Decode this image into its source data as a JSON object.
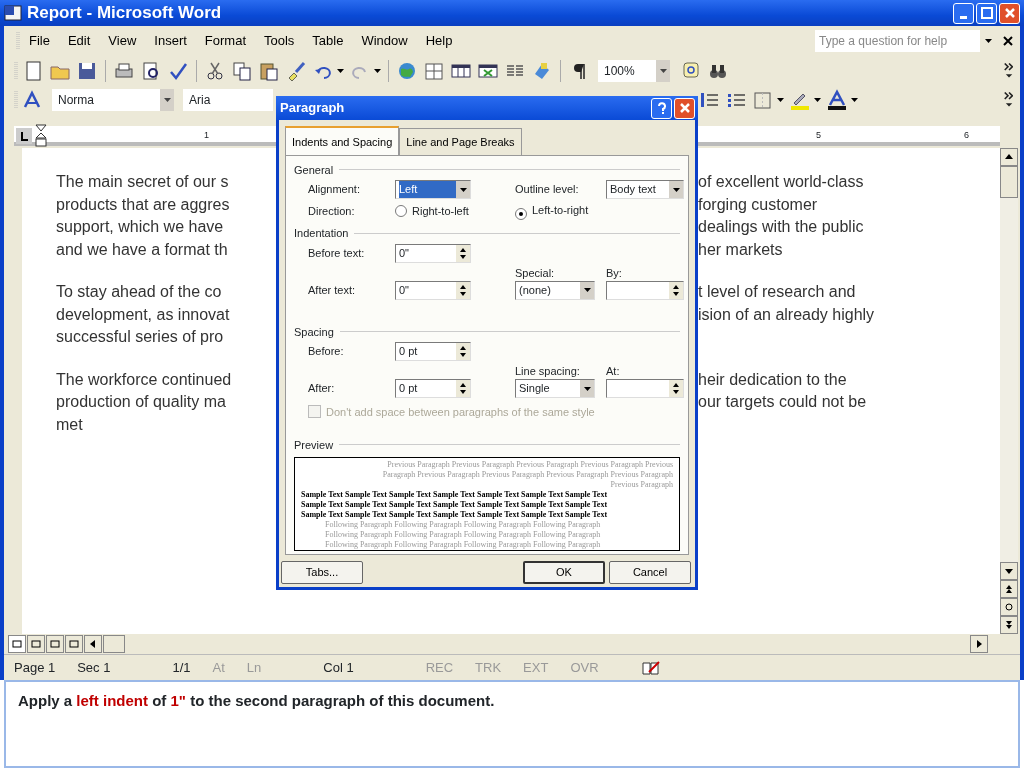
{
  "window": {
    "title": "Report - Microsoft Word"
  },
  "menu": [
    {
      "label": "File"
    },
    {
      "label": "Edit"
    },
    {
      "label": "View"
    },
    {
      "label": "Insert"
    },
    {
      "label": "Format"
    },
    {
      "label": "Tools"
    },
    {
      "label": "Table"
    },
    {
      "label": "Window"
    },
    {
      "label": "Help"
    }
  ],
  "help_box": {
    "placeholder": "Type a question for help"
  },
  "zoom_box": {
    "value": "100%"
  },
  "style_box": {
    "value": "Norma"
  },
  "font_box": {
    "value": "Aria"
  },
  "ruler": {
    "labels": [
      "1",
      "5",
      "6"
    ]
  },
  "document": {
    "paragraphs": [
      {
        "lines": [
          {
            "left": "The main secret of our s",
            "right": "of excellent world-class"
          },
          {
            "left": "products that are aggres",
            "right": "forging customer"
          },
          {
            "left": "support, which we have",
            "right": "dealings with the public"
          },
          {
            "left": "and we have a format th",
            "right": "her markets"
          }
        ]
      },
      {
        "lines": [
          {
            "left": "To stay ahead of the co",
            "right": "t level of research and"
          },
          {
            "left": "development, as innovat",
            "right": "ision of an already highly"
          },
          {
            "left": "successful series of pro"
          }
        ]
      },
      {
        "lines": [
          {
            "left": "The workforce continued",
            "right": "heir dedication to the"
          },
          {
            "left": "production of quality ma",
            "right": "our targets could not be"
          },
          {
            "left": "met"
          }
        ]
      }
    ]
  },
  "dialog": {
    "title": "Paragraph",
    "tabs": [
      {
        "label": "Indents and Spacing",
        "selected": true
      },
      {
        "label": "Line and Page Breaks",
        "selected": false
      }
    ],
    "general": {
      "heading": "General",
      "alignment": {
        "label": "Alignment:",
        "value": "Left",
        "highlighted": true
      },
      "outline_level": {
        "label": "Outline level:",
        "value": "Body text"
      },
      "direction": {
        "label": "Direction:",
        "options": [
          {
            "label": "Right-to-left",
            "selected": false
          },
          {
            "label": "Left-to-right",
            "selected": true
          }
        ]
      }
    },
    "indentation": {
      "heading": "Indentation",
      "before_text": {
        "label": "Before text:",
        "value": "0\""
      },
      "after_text": {
        "label": "After text:",
        "value": "0\""
      },
      "special": {
        "label": "Special:",
        "value": "(none)"
      },
      "by": {
        "label": "By:"
      }
    },
    "spacing": {
      "heading": "Spacing",
      "before": {
        "label": "Before:",
        "value": "0 pt"
      },
      "after": {
        "label": "After:",
        "value": "0 pt"
      },
      "line_spacing": {
        "label": "Line spacing:",
        "value": "Single"
      },
      "at": {
        "label": "At:"
      },
      "no_space_checkbox": {
        "label": "Don't add space between paragraphs of the same style",
        "checked": false,
        "disabled": true
      }
    },
    "preview": {
      "heading": "Preview",
      "previous": [
        "Previous Paragraph Previous Paragraph Previous Paragraph Previous Paragraph Previous",
        "Paragraph Previous Paragraph Previous Paragraph Previous Paragraph Previous Paragraph",
        "Previous Paragraph"
      ],
      "sample": [
        "Sample Text Sample Text Sample Text Sample Text Sample Text Sample Text Sample Text",
        "Sample Text Sample Text Sample Text Sample Text Sample Text Sample Text Sample Text",
        "Sample Text Sample Text Sample Text Sample Text Sample Text Sample Text Sample Text"
      ],
      "following": [
        "Following Paragraph Following Paragraph Following Paragraph Following Paragraph",
        "Following Paragraph Following Paragraph Following Paragraph Following Paragraph",
        "Following Paragraph Following Paragraph Following Paragraph Following Paragraph"
      ]
    },
    "buttons": [
      {
        "label": "Tabs...",
        "default": false
      },
      {
        "label": "OK",
        "default": true
      },
      {
        "label": "Cancel",
        "default": false
      }
    ]
  },
  "status_bar": [
    {
      "text": "Page 1",
      "enabled": true
    },
    {
      "text": "Sec 1",
      "enabled": true
    },
    {
      "text": "1/1",
      "enabled": true
    },
    {
      "text": "At",
      "enabled": false
    },
    {
      "text": "Ln",
      "enabled": false
    },
    {
      "text": "Col 1",
      "enabled": true
    },
    {
      "text": "REC",
      "enabled": false
    },
    {
      "text": "TRK",
      "enabled": false
    },
    {
      "text": "EXT",
      "enabled": false
    },
    {
      "text": "OVR",
      "enabled": false
    }
  ],
  "instruction": {
    "parts": [
      {
        "text": "Apply a ",
        "highlight": false
      },
      {
        "text": "left indent",
        "highlight": true
      },
      {
        "text": " of ",
        "highlight": false
      },
      {
        "text": "1\"",
        "highlight": true
      },
      {
        "text": " to the second paragraph of this document.",
        "highlight": false
      }
    ]
  }
}
